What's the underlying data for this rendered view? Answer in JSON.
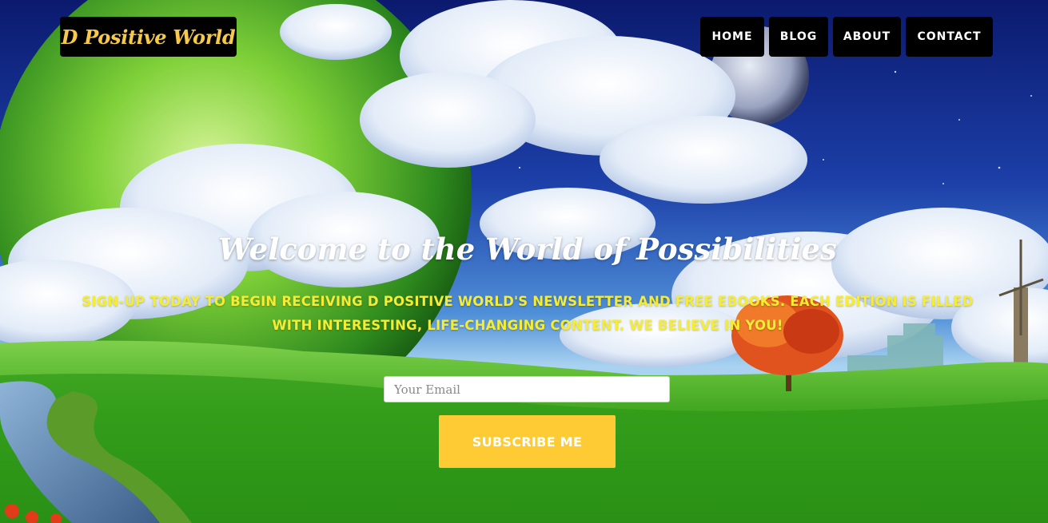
{
  "header": {
    "logo_text": "D Positive World",
    "nav": {
      "home": "HOME",
      "blog": "BLOG",
      "about": "ABOUT",
      "contact": "CONTACT"
    }
  },
  "hero": {
    "headline": "Welcome to the World of Possibilities",
    "tagline": "SIGN-UP TODAY TO BEGIN RECEIVING D POSITIVE WORLD'S NEWSLETTER AND FREE EBOOKS. EACH EDITION IS FILLED WITH INTERESTING, LIFE-CHANGING CONTENT. WE BELIEVE IN YOU!",
    "email_placeholder": "Your Email",
    "subscribe_label": "SUBSCRIBE ME"
  },
  "colors": {
    "logo_text": "#f6c94a",
    "tagline": "#f4ec35",
    "button": "#fecb35",
    "nav_bg": "#000000"
  }
}
